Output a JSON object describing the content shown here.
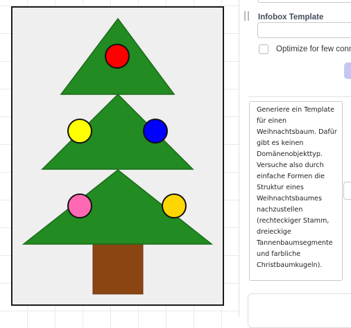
{
  "canvas": {
    "frame_fill": "#efefef",
    "frame_stroke": "#1a1a1a",
    "tree_green": "#228b22",
    "tree_outline": "#1a6b1a",
    "trunk_color": "#8b4513",
    "ornaments": [
      {
        "name": "ornament-red",
        "color": "#ff0000"
      },
      {
        "name": "ornament-yellow-left",
        "color": "#ffff00"
      },
      {
        "name": "ornament-blue",
        "color": "#0000ff"
      },
      {
        "name": "ornament-pink",
        "color": "#ff69b4"
      },
      {
        "name": "ornament-gold",
        "color": "#ffd700"
      }
    ]
  },
  "panel": {
    "infobox_label": "Infobox Template",
    "infobox_value": "",
    "optimize_label": "Optimize for few connections",
    "optimize_checked": false,
    "prompt_text": "Generiere ein Template für einen Weihnachtsbaum. Dafür gibt es keinen Domänenobjekttyp. Versuche also durch einfache Formen die Struktur eines Weihnachtsbaumes nachzustellen (rechteckiger Stamm, dreieckige Tannenbaumsegmente und farbliche Christbaumkugeln)."
  },
  "icons": {
    "panel_grip": "drag-handle-icon",
    "checkbox": "checkbox-icon"
  }
}
